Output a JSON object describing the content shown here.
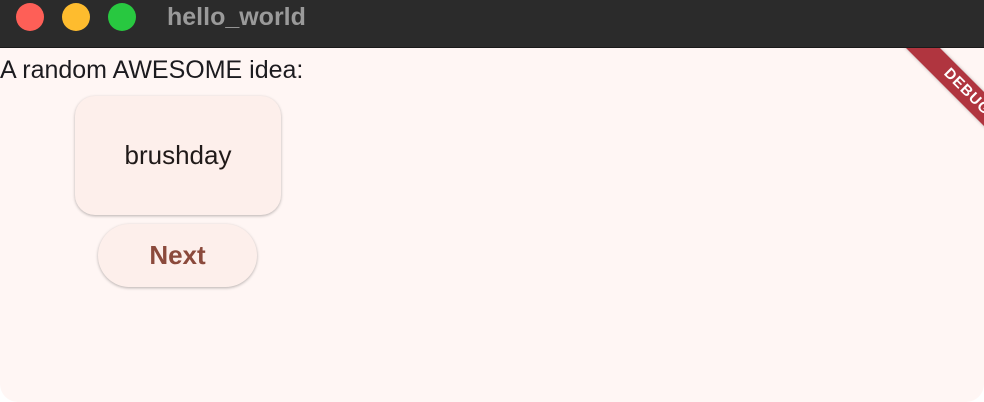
{
  "window": {
    "title": "hello_world"
  },
  "intro": {
    "text": "A random AWESOME idea:"
  },
  "idea": {
    "word": "brushday"
  },
  "actions": {
    "next_label": "Next"
  },
  "debug": {
    "label": "DEBUG"
  },
  "colors": {
    "background": "#fff6f4",
    "card": "#fdefeb",
    "button_text": "#8b4a3c",
    "debug_ribbon": "#b0353f",
    "titlebar": "#2b2b2b"
  }
}
